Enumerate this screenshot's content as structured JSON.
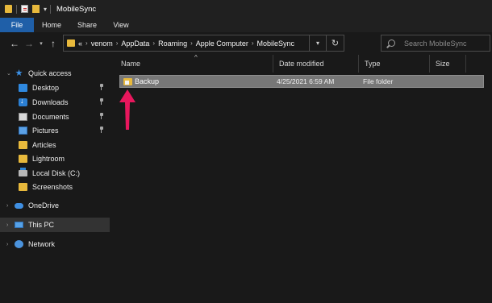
{
  "window": {
    "title": "MobileSync",
    "quick_access_dropdown": "▾"
  },
  "ribbon": {
    "tabs": [
      "File",
      "Home",
      "Share",
      "View"
    ]
  },
  "navigation": {
    "back": "←",
    "forward": "→",
    "recent": "▾",
    "up": "↑",
    "refresh": "↻",
    "address_dropdown": "▾",
    "breadcrumb_overflow": "«",
    "breadcrumb_separator": "›",
    "breadcrumbs": [
      "venom",
      "AppData",
      "Roaming",
      "Apple Computer",
      "MobileSync"
    ]
  },
  "search": {
    "placeholder": "Search MobileSync"
  },
  "sidebar": {
    "items": [
      {
        "label": "Quick access",
        "icon": "star-icon"
      },
      {
        "label": "Desktop",
        "icon": "desktop-icon",
        "pinned": true
      },
      {
        "label": "Downloads",
        "icon": "downloads-icon",
        "pinned": true
      },
      {
        "label": "Documents",
        "icon": "documents-icon",
        "pinned": true
      },
      {
        "label": "Pictures",
        "icon": "pictures-icon",
        "pinned": true
      },
      {
        "label": "Articles",
        "icon": "folder-icon"
      },
      {
        "label": "Lightroom",
        "icon": "folder-icon"
      },
      {
        "label": "Local Disk (C:)",
        "icon": "disk-icon"
      },
      {
        "label": "Screenshots",
        "icon": "folder-icon"
      },
      {
        "label": "OneDrive",
        "icon": "cloud-icon"
      },
      {
        "label": "This PC",
        "icon": "pc-icon",
        "selected": true
      },
      {
        "label": "Network",
        "icon": "network-icon"
      }
    ]
  },
  "file_list": {
    "columns": [
      "Name",
      "Date modified",
      "Type",
      "Size"
    ],
    "sort_indicator": "^",
    "rows": [
      {
        "name": "Backup",
        "date_modified": "4/25/2021 6:59 AM",
        "type": "File folder",
        "size": "",
        "selected": true
      }
    ]
  },
  "colors": {
    "accent": "#1f5fa8",
    "folder": "#e8b93c",
    "annotation_arrow": "#e8175d",
    "selection": "#777777"
  }
}
